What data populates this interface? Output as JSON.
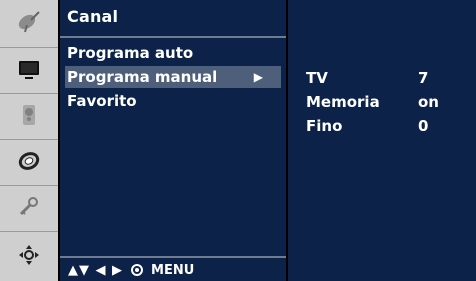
{
  "menu": {
    "title": "Canal",
    "items": [
      {
        "label": "Programa auto"
      },
      {
        "label": "Programa  manual"
      },
      {
        "label": "Favorito"
      }
    ],
    "footer": {
      "nav_arrows": "▲▼ ◀ ▶",
      "menu_label": "MENU"
    }
  },
  "detail": {
    "rows": [
      {
        "label": "TV",
        "value": "7"
      },
      {
        "label": "Memoria",
        "value": "on"
      },
      {
        "label": "Fino",
        "value": "0"
      }
    ]
  },
  "rail": {
    "icons": [
      "satellite-dish-icon",
      "screen-icon",
      "speaker-icon",
      "clock-icon",
      "key-icon",
      "joystick-icon"
    ]
  },
  "colors": {
    "panel_bg": "#0c2248",
    "highlight_bg": "#4d5f7a",
    "rail_bg": "#cfcfcf"
  }
}
